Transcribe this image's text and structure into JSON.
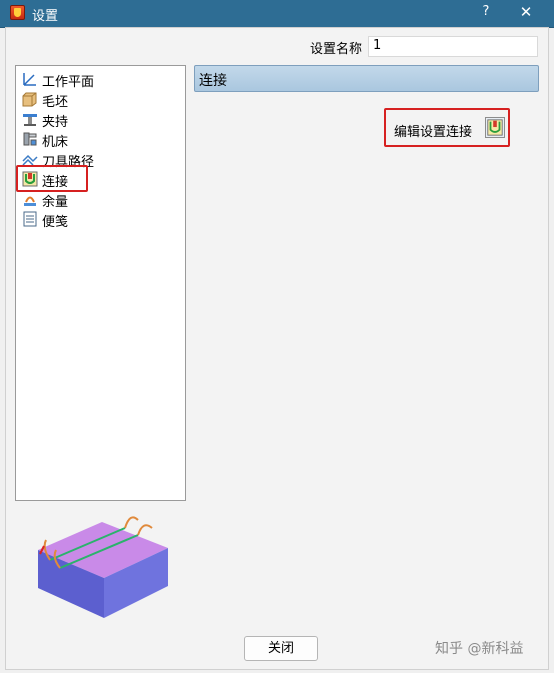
{
  "window": {
    "title": "设置",
    "help_label": "?",
    "close_label": "✕"
  },
  "setup_name": {
    "label": "设置名称",
    "value": "1"
  },
  "tree": {
    "items": [
      {
        "label": "工作平面",
        "icon": "workplane-icon"
      },
      {
        "label": "毛坯",
        "icon": "block-icon"
      },
      {
        "label": "夹持",
        "icon": "fixture-icon"
      },
      {
        "label": "机床",
        "icon": "machine-icon"
      },
      {
        "label": "刀具路径",
        "icon": "toolpath-icon"
      },
      {
        "label": "连接",
        "icon": "connection-icon",
        "selected": true
      },
      {
        "label": "余量",
        "icon": "stock-allowance-icon"
      },
      {
        "label": "便笺",
        "icon": "notes-icon"
      }
    ]
  },
  "panel": {
    "header": "连接",
    "edit_connection_label": "编辑设置连接",
    "edit_icon": "edit-connection-icon"
  },
  "footer": {
    "close_label": "关闭"
  },
  "watermark": "知乎 @新科益",
  "colors": {
    "titlebar": "#2e6d94",
    "highlight": "#d62020",
    "header_bar": "#b6cfe4"
  }
}
